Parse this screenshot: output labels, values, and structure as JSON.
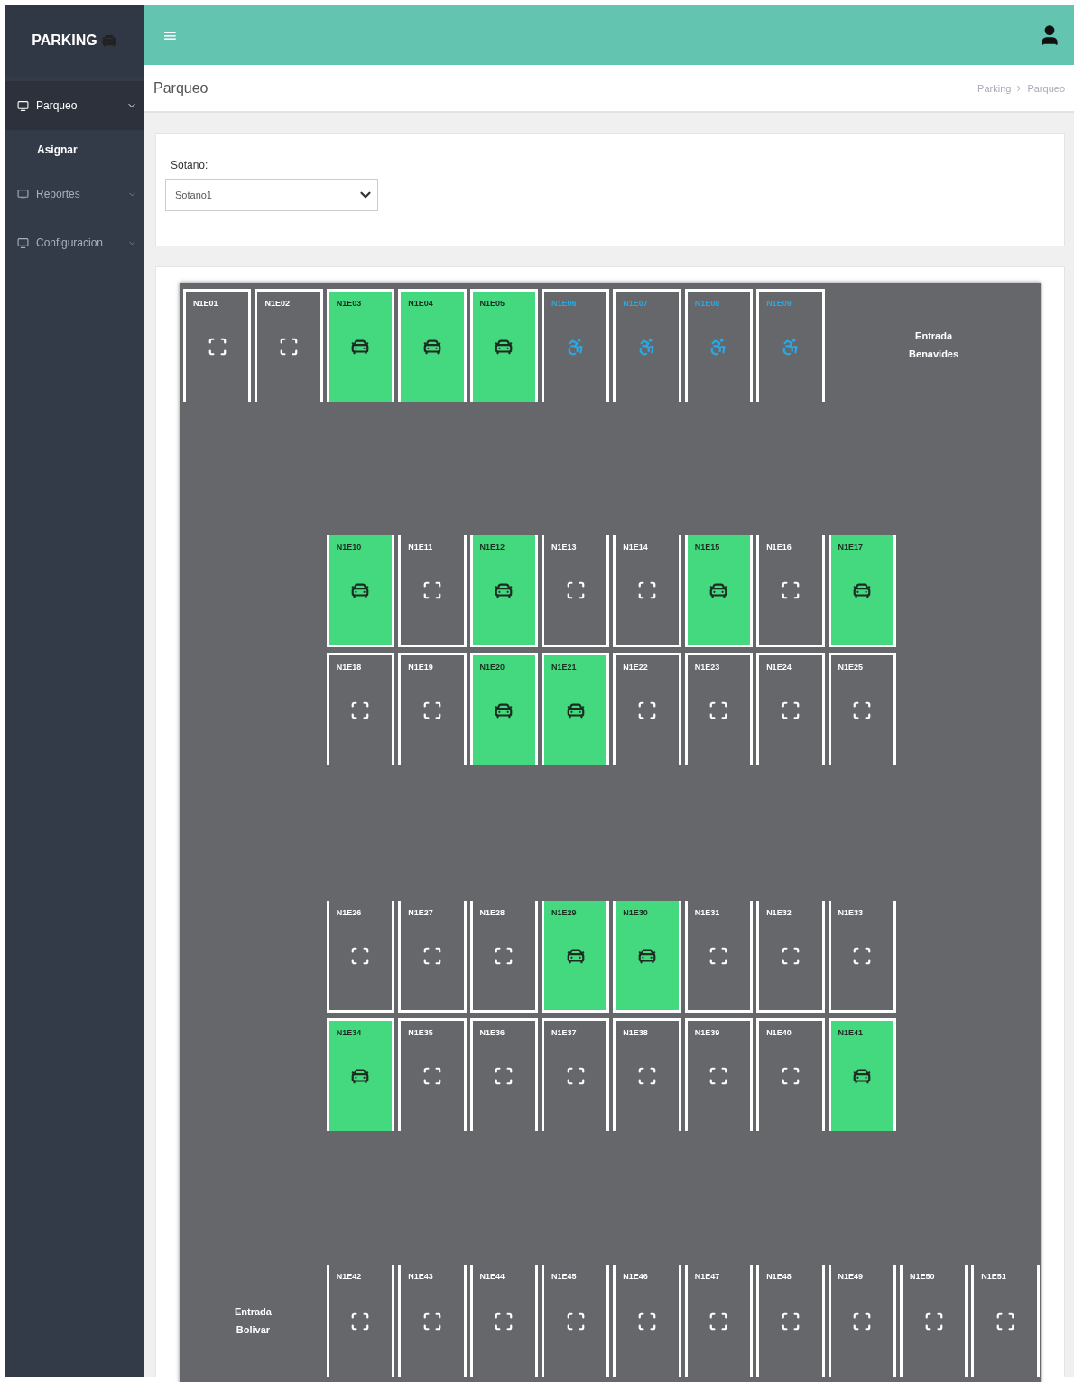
{
  "sidebar": {
    "brand": "PARKING",
    "items": [
      {
        "label": "Parqueo",
        "selected": true,
        "expanded": true,
        "children": [
          {
            "label": "Asignar"
          }
        ]
      },
      {
        "label": "Reportes",
        "selected": false,
        "expanded": false
      },
      {
        "label": "Configuracion",
        "selected": false,
        "expanded": false
      }
    ]
  },
  "header": {
    "menu_glyph": "≡"
  },
  "page_title": "Parqueo",
  "breadcrumb": [
    "Parking",
    "Parqueo"
  ],
  "filter": {
    "label": "Sotano:",
    "value": "Sotano1"
  },
  "lot": {
    "top_row": {
      "entrance": "Entrada Benavides",
      "slots": [
        {
          "code": "N1E01",
          "kind": "free"
        },
        {
          "code": "N1E02",
          "kind": "free"
        },
        {
          "code": "N1E03",
          "kind": "occupied"
        },
        {
          "code": "N1E04",
          "kind": "occupied"
        },
        {
          "code": "N1E05",
          "kind": "occupied"
        },
        {
          "code": "N1E06",
          "kind": "accessible"
        },
        {
          "code": "N1E07",
          "kind": "accessible"
        },
        {
          "code": "N1E08",
          "kind": "accessible"
        },
        {
          "code": "N1E09",
          "kind": "accessible"
        }
      ]
    },
    "blocks": [
      {
        "upper": [
          {
            "code": "N1E10",
            "kind": "occupied"
          },
          {
            "code": "N1E11",
            "kind": "free"
          },
          {
            "code": "N1E12",
            "kind": "occupied"
          },
          {
            "code": "N1E13",
            "kind": "free"
          },
          {
            "code": "N1E14",
            "kind": "free"
          },
          {
            "code": "N1E15",
            "kind": "occupied"
          },
          {
            "code": "N1E16",
            "kind": "free"
          },
          {
            "code": "N1E17",
            "kind": "occupied"
          }
        ],
        "lower": [
          {
            "code": "N1E18",
            "kind": "free"
          },
          {
            "code": "N1E19",
            "kind": "free"
          },
          {
            "code": "N1E20",
            "kind": "occupied"
          },
          {
            "code": "N1E21",
            "kind": "occupied"
          },
          {
            "code": "N1E22",
            "kind": "free"
          },
          {
            "code": "N1E23",
            "kind": "free"
          },
          {
            "code": "N1E24",
            "kind": "free"
          },
          {
            "code": "N1E25",
            "kind": "free"
          }
        ]
      },
      {
        "upper": [
          {
            "code": "N1E26",
            "kind": "free"
          },
          {
            "code": "N1E27",
            "kind": "free"
          },
          {
            "code": "N1E28",
            "kind": "free"
          },
          {
            "code": "N1E29",
            "kind": "occupied"
          },
          {
            "code": "N1E30",
            "kind": "occupied"
          },
          {
            "code": "N1E31",
            "kind": "free"
          },
          {
            "code": "N1E32",
            "kind": "free"
          },
          {
            "code": "N1E33",
            "kind": "free"
          }
        ],
        "lower": [
          {
            "code": "N1E34",
            "kind": "occupied"
          },
          {
            "code": "N1E35",
            "kind": "free"
          },
          {
            "code": "N1E36",
            "kind": "free"
          },
          {
            "code": "N1E37",
            "kind": "free"
          },
          {
            "code": "N1E38",
            "kind": "free"
          },
          {
            "code": "N1E39",
            "kind": "free"
          },
          {
            "code": "N1E40",
            "kind": "free"
          },
          {
            "code": "N1E41",
            "kind": "occupied"
          }
        ]
      }
    ],
    "bottom_row": {
      "entrance": "Entrada Bolivar",
      "slots": [
        {
          "code": "N1E42",
          "kind": "free"
        },
        {
          "code": "N1E43",
          "kind": "free"
        },
        {
          "code": "N1E44",
          "kind": "free"
        },
        {
          "code": "N1E45",
          "kind": "free"
        },
        {
          "code": "N1E46",
          "kind": "free"
        },
        {
          "code": "N1E47",
          "kind": "free"
        },
        {
          "code": "N1E48",
          "kind": "free"
        },
        {
          "code": "N1E49",
          "kind": "free"
        },
        {
          "code": "N1E50",
          "kind": "free"
        },
        {
          "code": "N1E51",
          "kind": "free"
        }
      ]
    }
  }
}
